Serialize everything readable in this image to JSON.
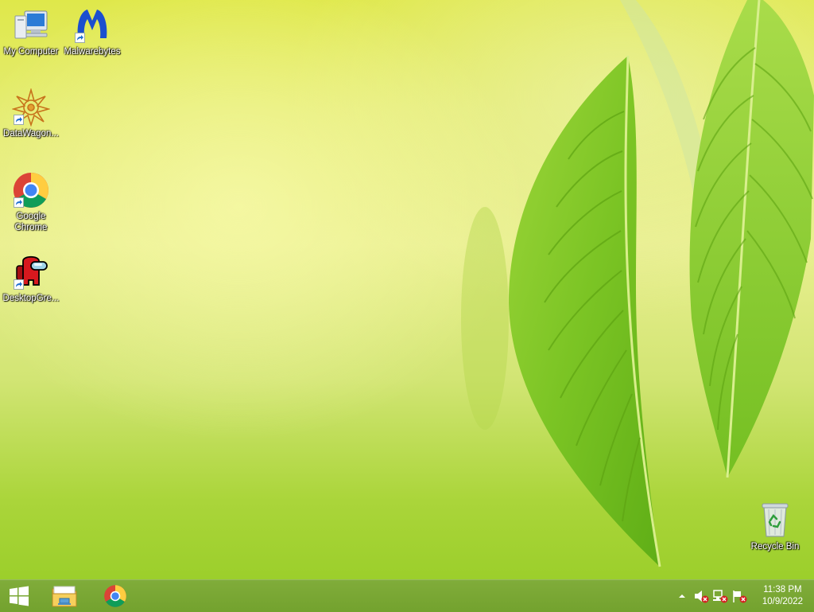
{
  "desktop": {
    "icons": [
      {
        "label": "My Computer"
      },
      {
        "label": "Malwarebytes"
      },
      {
        "label": "DataWagon..."
      },
      {
        "label": "Google Chrome"
      },
      {
        "label": "DesktopGre..."
      },
      {
        "label": "Recycle Bin"
      }
    ]
  },
  "taskbar": {
    "pinned": [
      {
        "icon": "windows-start-icon"
      },
      {
        "icon": "file-explorer-icon"
      },
      {
        "icon": "chrome-icon"
      }
    ],
    "tray": {
      "icons": [
        "show-hidden-icons-chevron",
        "volume-muted-icon",
        "network-error-icon",
        "action-center-flag-icon"
      ]
    },
    "clock": {
      "time": "11:38 PM",
      "date": "10/9/2022"
    }
  },
  "colors": {
    "taskbar": "#79a733",
    "wallpaper_top": "#dfe84a",
    "wallpaper_bottom": "#96cc25",
    "leaf": "#7fc22a"
  }
}
